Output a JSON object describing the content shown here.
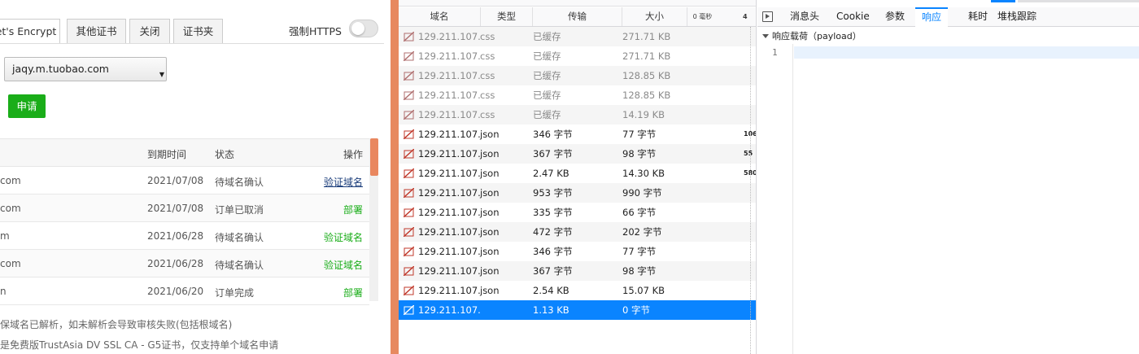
{
  "left": {
    "tabs": [
      {
        "label": "et's Encrypt"
      },
      {
        "label": "其他证书"
      },
      {
        "label": "关闭"
      },
      {
        "label": "证书夹"
      }
    ],
    "https_label": "强制HTTPS",
    "https_enabled": false,
    "domain_select": {
      "value": "jaqy.m.tuobao.com"
    },
    "apply_label": "申请",
    "table": {
      "headers": {
        "expire": "到期时间",
        "status": "状态",
        "action": "操作"
      },
      "rows": [
        {
          "domain": "com",
          "expire": "2021/07/08",
          "status": "待域名确认",
          "action": "验证域名"
        },
        {
          "domain": "com",
          "expire": "2021/07/08",
          "status": "订单已取消",
          "action": "部署"
        },
        {
          "domain": "m",
          "expire": "2021/06/28",
          "status": "待域名确认",
          "action": "验证域名"
        },
        {
          "domain": "com",
          "expire": "2021/06/28",
          "status": "待域名确认",
          "action": "验证域名"
        },
        {
          "domain": "n",
          "expire": "2021/06/20",
          "status": "订单完成",
          "action": "部署"
        }
      ]
    },
    "notes": [
      "保域名已解析，如未解析会导致审核失败(包括根域名)",
      "是免费版TrustAsia DV SSL CA - G5证书，仅支持单个域名申请"
    ]
  },
  "network": {
    "headers": {
      "domain": "域名",
      "type": "类型",
      "transferred": "传输",
      "size": "大小",
      "waterfall": "0 毫秒",
      "waterfall_tick": "4"
    },
    "rows": [
      {
        "domain": "129.211.107....",
        "type": "css",
        "transferred": "已缓存",
        "size": "271.71 KB",
        "wf": "",
        "cached": true
      },
      {
        "domain": "129.211.107....",
        "type": "css",
        "transferred": "已缓存",
        "size": "271.71 KB",
        "wf": "",
        "cached": true
      },
      {
        "domain": "129.211.107....",
        "type": "css",
        "transferred": "已缓存",
        "size": "128.85 KB",
        "wf": "",
        "cached": true
      },
      {
        "domain": "129.211.107....",
        "type": "css",
        "transferred": "已缓存",
        "size": "128.85 KB",
        "wf": "",
        "cached": true
      },
      {
        "domain": "129.211.107....",
        "type": "css",
        "transferred": "已缓存",
        "size": "14.19 KB",
        "wf": "",
        "cached": true
      },
      {
        "domain": "129.211.107....",
        "type": "json",
        "transferred": "346 字节",
        "size": "77 字节",
        "wf": "106",
        "cached": false
      },
      {
        "domain": "129.211.107....",
        "type": "json",
        "transferred": "367 字节",
        "size": "98 字节",
        "wf": "55",
        "cached": false
      },
      {
        "domain": "129.211.107....",
        "type": "json",
        "transferred": "2.47 KB",
        "size": "14.30 KB",
        "wf": "580",
        "cached": false
      },
      {
        "domain": "129.211.107....",
        "type": "json",
        "transferred": "953 字节",
        "size": "990 字节",
        "wf": "",
        "cached": false
      },
      {
        "domain": "129.211.107....",
        "type": "json",
        "transferred": "335 字节",
        "size": "66 字节",
        "wf": "",
        "cached": false
      },
      {
        "domain": "129.211.107....",
        "type": "json",
        "transferred": "472 字节",
        "size": "202 字节",
        "wf": "",
        "cached": false
      },
      {
        "domain": "129.211.107....",
        "type": "json",
        "transferred": "346 字节",
        "size": "77 字节",
        "wf": "",
        "cached": false
      },
      {
        "domain": "129.211.107....",
        "type": "json",
        "transferred": "367 字节",
        "size": "98 字节",
        "wf": "",
        "cached": false
      },
      {
        "domain": "129.211.107....",
        "type": "json",
        "transferred": "2.54 KB",
        "size": "15.07 KB",
        "wf": "",
        "cached": false
      },
      {
        "domain": "129.211.107....",
        "type": "",
        "transferred": "1.13 KB",
        "size": "0 字节",
        "wf": "",
        "cached": false,
        "selected": true
      }
    ]
  },
  "response": {
    "tabs": [
      {
        "label": "消息头"
      },
      {
        "label": "Cookie"
      },
      {
        "label": "参数"
      },
      {
        "label": "响应",
        "active": true
      },
      {
        "label": "耗时"
      },
      {
        "label": "堆栈跟踪"
      }
    ],
    "payload_title": "响应载荷（payload）",
    "line_number": "1"
  },
  "colors": {
    "accent": "#0a84ff",
    "green": "#1aad19",
    "divider": "#e7895f"
  }
}
